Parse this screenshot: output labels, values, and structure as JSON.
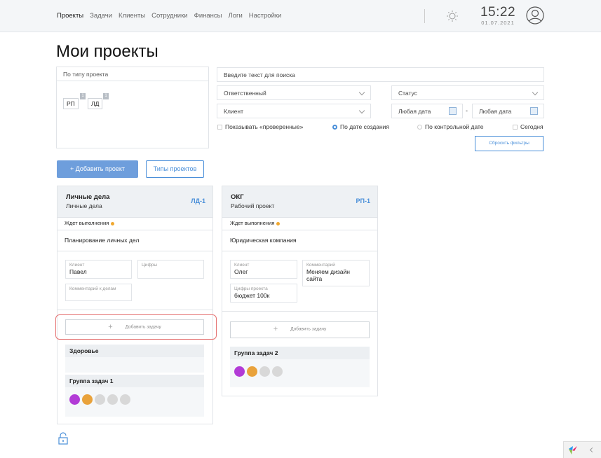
{
  "nav": {
    "items": [
      "Проекты",
      "Задачи",
      "Клиенты",
      "Сотрудники",
      "Финансы",
      "Логи",
      "Настройки"
    ]
  },
  "clock": {
    "time": "15:22",
    "date": "01.07.2021"
  },
  "page_title": "Мои проекты",
  "filters": {
    "type_label": "По типу проекта",
    "chips": [
      {
        "label": "РП",
        "count": "1"
      },
      {
        "label": "ЛД",
        "count": "1"
      }
    ],
    "search_placeholder": "Введите текст для поиска",
    "responsible": "Ответственный",
    "status": "Статус",
    "client": "Клиент",
    "date_from": "Любая дата",
    "date_dash": "-",
    "date_to": "Любая дата",
    "show_checked": "Показывать «проверенные»",
    "by_created": "По дате создания",
    "by_control": "По контрольной дате",
    "today": "Сегодня",
    "reset": "Сбросить фильтры"
  },
  "actions": {
    "add_project": "+ Добавить проект",
    "project_types": "Типы проектов"
  },
  "cards": [
    {
      "name": "Личные дела",
      "type": "Личные дела",
      "code": "ЛД-1",
      "status": "Ждет выполнения",
      "desc": "Планирование личных дел",
      "client_label": "Клиент",
      "client_value": "Павел",
      "numbers_label": "Цифры",
      "comment_label": "Комментарий к делам",
      "add_task": "Добавить задачу",
      "groups": [
        "Здоровье",
        "Группа задач 1"
      ]
    },
    {
      "name": "ОКГ",
      "type": "Рабочий проект",
      "code": "РП-1",
      "status": "Ждет выполнения",
      "desc": "Юридическая компания",
      "client_label": "Клиент",
      "client_value": "Олег",
      "comment_label": "Комментарий",
      "comment_value": "Меняем дизайн сайта",
      "numbers_label": "Цифры проекта",
      "numbers_value": "бюджет 100к",
      "add_task": "Добавить задачу",
      "groups": [
        "Группа задач 2"
      ]
    }
  ],
  "colors": {
    "accent": "#4a8fd9",
    "purple": "#b23bd6",
    "orange": "#e9a23b",
    "gray": "#d8d8d8",
    "pending": "#f0a830"
  }
}
